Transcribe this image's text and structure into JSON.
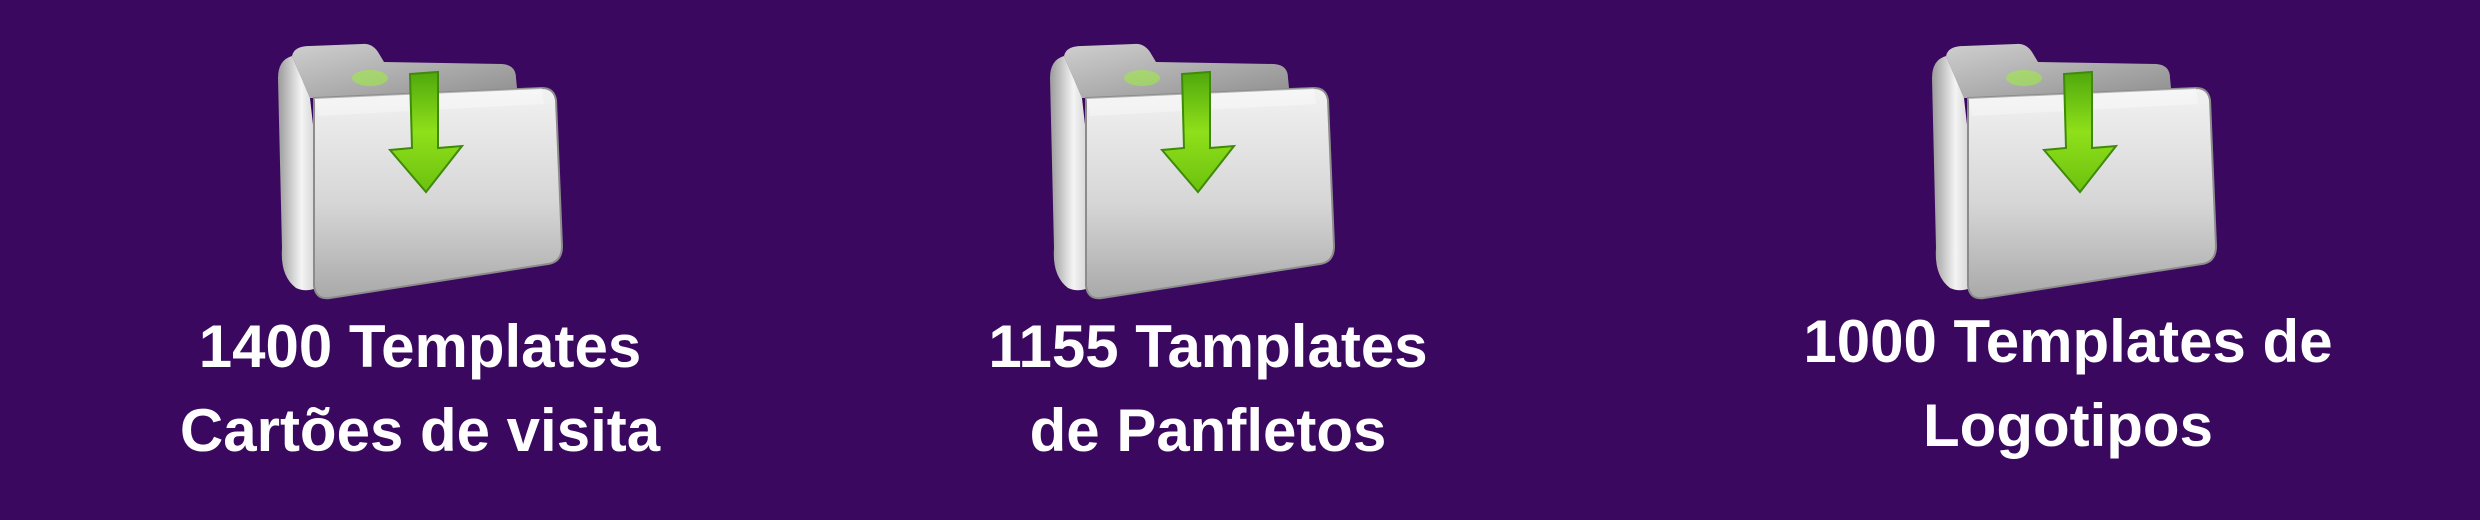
{
  "downloads": [
    {
      "icon": "download-folder-icon",
      "line1": "1400 Templates",
      "line2": "Cartões de visita"
    },
    {
      "icon": "download-folder-icon",
      "line1": "1155 Tamplates",
      "line2": "de Panfletos"
    },
    {
      "icon": "download-folder-icon",
      "line1": "1000 Templates de",
      "line2": "Logotipos"
    }
  ],
  "colors": {
    "background": "#3a085e",
    "text": "#ffffff",
    "arrow": "#7fd40a",
    "folder": "#d9d9d9"
  }
}
